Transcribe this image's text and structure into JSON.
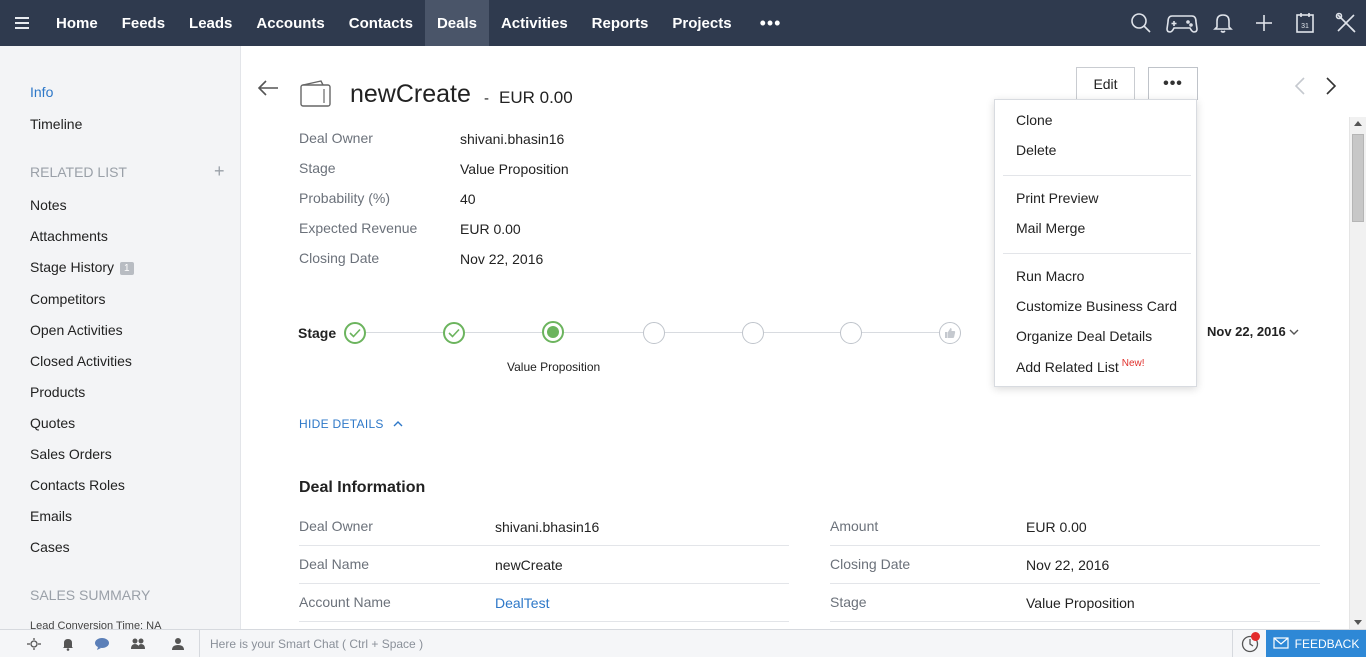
{
  "nav": {
    "menu_icon": "hamburger-icon",
    "items": [
      {
        "label": "Home"
      },
      {
        "label": "Feeds"
      },
      {
        "label": "Leads"
      },
      {
        "label": "Accounts"
      },
      {
        "label": "Contacts"
      },
      {
        "label": "Deals",
        "active": true
      },
      {
        "label": "Activities"
      },
      {
        "label": "Reports"
      },
      {
        "label": "Projects"
      }
    ],
    "more_label": "•••",
    "right_icons": [
      "search-icon",
      "gamepad-icon",
      "bell-icon",
      "plus-icon",
      "calendar-icon",
      "tools-icon"
    ],
    "calendar_day": "31"
  },
  "sidebar": {
    "info": "Info",
    "timeline": "Timeline",
    "related_list_header": "RELATED LIST",
    "related_plus": "+",
    "related": [
      {
        "label": "Notes"
      },
      {
        "label": "Attachments"
      },
      {
        "label": "Stage History",
        "badge": "1"
      },
      {
        "label": "Competitors"
      },
      {
        "label": "Open Activities"
      },
      {
        "label": "Closed Activities"
      },
      {
        "label": "Products"
      },
      {
        "label": "Quotes"
      },
      {
        "label": "Sales Orders"
      },
      {
        "label": "Contacts Roles"
      },
      {
        "label": "Emails"
      },
      {
        "label": "Cases"
      }
    ],
    "sales_summary_header": "SALES SUMMARY",
    "lead_conversion": "Lead Conversion Time: NA"
  },
  "record": {
    "title": "newCreate",
    "separator": "-",
    "amount": "EUR 0.00",
    "edit_label": "Edit",
    "more_label": "•••",
    "summary": [
      {
        "label": "Deal Owner",
        "value": "shivani.bhasin16"
      },
      {
        "label": "Stage",
        "value": "Value Proposition"
      },
      {
        "label": "Probability (%)",
        "value": "40"
      },
      {
        "label": "Expected Revenue",
        "value": "EUR 0.00"
      },
      {
        "label": "Closing Date",
        "value": "Nov 22, 2016"
      }
    ]
  },
  "stage": {
    "label": "Stage",
    "current": "Value Proposition",
    "date": "Nov 22, 2016",
    "steps": [
      "done",
      "done",
      "current",
      "pending",
      "pending",
      "pending",
      "won"
    ]
  },
  "details": {
    "hide_label": "HIDE DETAILS",
    "section_title": "Deal Information",
    "left": [
      {
        "label": "Deal Owner",
        "value": "shivani.bhasin16"
      },
      {
        "label": "Deal Name",
        "value": "newCreate"
      },
      {
        "label": "Account Name",
        "value": "DealTest",
        "link": true
      }
    ],
    "right": [
      {
        "label": "Amount",
        "value": "EUR 0.00"
      },
      {
        "label": "Closing Date",
        "value": "Nov 22, 2016"
      },
      {
        "label": "Stage",
        "value": "Value Proposition"
      }
    ]
  },
  "dropdown": {
    "items": [
      {
        "label": "Clone"
      },
      {
        "label": "Delete"
      },
      {
        "label": "Print Preview"
      },
      {
        "label": "Mail Merge"
      },
      {
        "label": "Run Macro"
      },
      {
        "label": "Customize Business Card"
      },
      {
        "label": "Organize Deal Details"
      },
      {
        "label": "Add Related List",
        "badge": "New!"
      }
    ]
  },
  "bottombar": {
    "smart_chat_placeholder": "Here is your Smart Chat ( Ctrl + Space )",
    "feedback_label": "FEEDBACK",
    "icons": [
      "settings-icon",
      "bell-icon",
      "chat-icon",
      "users-icon",
      "person-icon",
      "clock-icon",
      "mail-icon"
    ]
  },
  "colors": {
    "nav_bg": "#2f3a4e",
    "nav_active": "#4a5569",
    "accent_blue": "#2e78c8",
    "stage_green": "#6cb45e",
    "feedback_bg": "#2e88d6",
    "new_red": "#e0312d"
  }
}
